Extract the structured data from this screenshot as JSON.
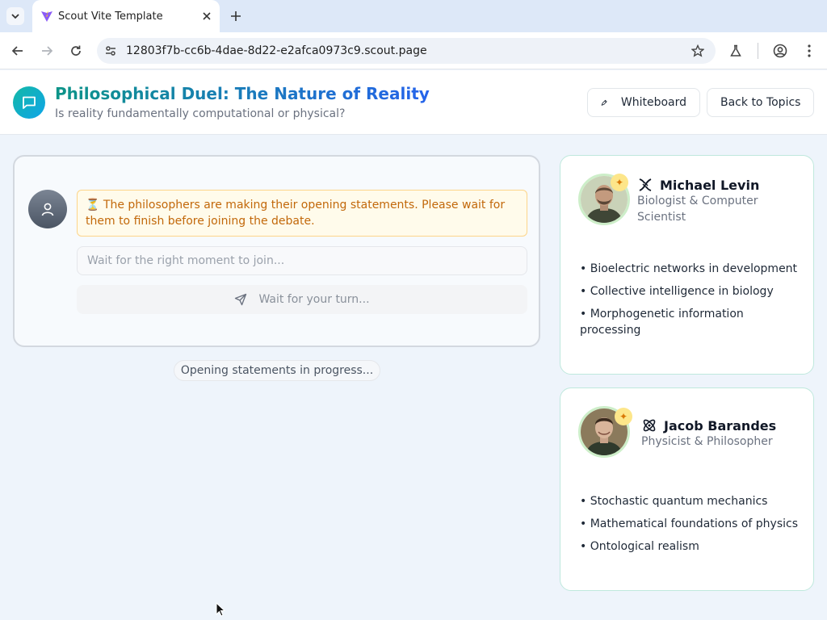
{
  "browser": {
    "tab_title": "Scout Vite Template",
    "url": "12803f7b-cc6b-4dae-8d22-e2afca0973c9.scout.page"
  },
  "header": {
    "title": "Philosophical Duel: The Nature of Reality",
    "subtitle": "Is reality fundamentally computational or physical?",
    "whiteboard_label": "Whiteboard",
    "back_label": "Back to Topics"
  },
  "chat": {
    "notice_icon": "⏳",
    "notice": "The philosophers are making their opening statements. Please wait for them to finish before joining the debate.",
    "input_placeholder": "Wait for the right moment to join...",
    "send_label": "Wait for your turn...",
    "status": "Opening statements in progress..."
  },
  "philosophers": [
    {
      "name": "Michael Levin",
      "role": "Biologist & Computer Scientist",
      "icon": "dna-icon",
      "topics": [
        "Bioelectric networks in development",
        "Collective intelligence in biology",
        "Morphogenetic information processing"
      ]
    },
    {
      "name": "Jacob Barandes",
      "role": "Physicist & Philosopher",
      "icon": "atom-icon",
      "topics": [
        "Stochastic quantum mechanics",
        "Mathematical foundations of physics",
        "Ontological realism"
      ]
    }
  ],
  "colors": {
    "accent_teal": "#0d9488",
    "accent_blue": "#2563eb",
    "notice_text": "#c2680a",
    "notice_bg": "#fffbeb"
  }
}
